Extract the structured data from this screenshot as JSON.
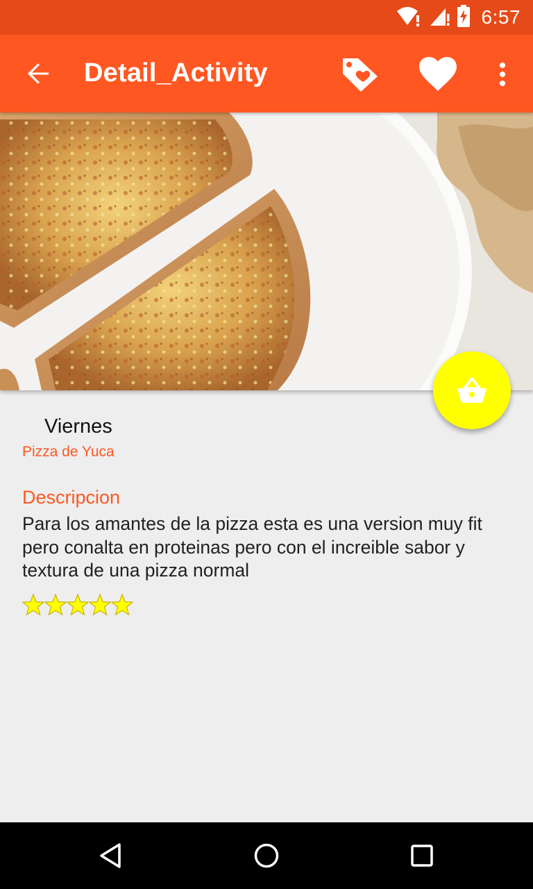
{
  "status_bar": {
    "time": "6:57",
    "icons": [
      "wifi-alert-icon",
      "signal-alert-icon",
      "battery-charging-icon"
    ],
    "color": "#e64a19"
  },
  "app_bar": {
    "title": "Detail_Activity",
    "color": "#ff5722",
    "icons": [
      "back-arrow-icon",
      "tag-heart-icon",
      "heart-icon",
      "more-vert-icon"
    ]
  },
  "hero": {
    "image": "pizza-photo"
  },
  "fab": {
    "icon": "shopping-basket-icon",
    "color": "#ffff00"
  },
  "detail": {
    "day": "Viernes",
    "item_name": "Pizza de Yuca",
    "description_heading": "Descripcion",
    "description": "Para los amantes de la pizza esta es una version muy fit pero conalta en proteinas pero con el increible sabor y textura de una pizza normal",
    "rating": 5,
    "rating_max": 5,
    "accent_color": "#ff5722"
  },
  "nav_bar": {
    "icons": [
      "nav-back-icon",
      "nav-home-icon",
      "nav-recents-icon"
    ]
  }
}
